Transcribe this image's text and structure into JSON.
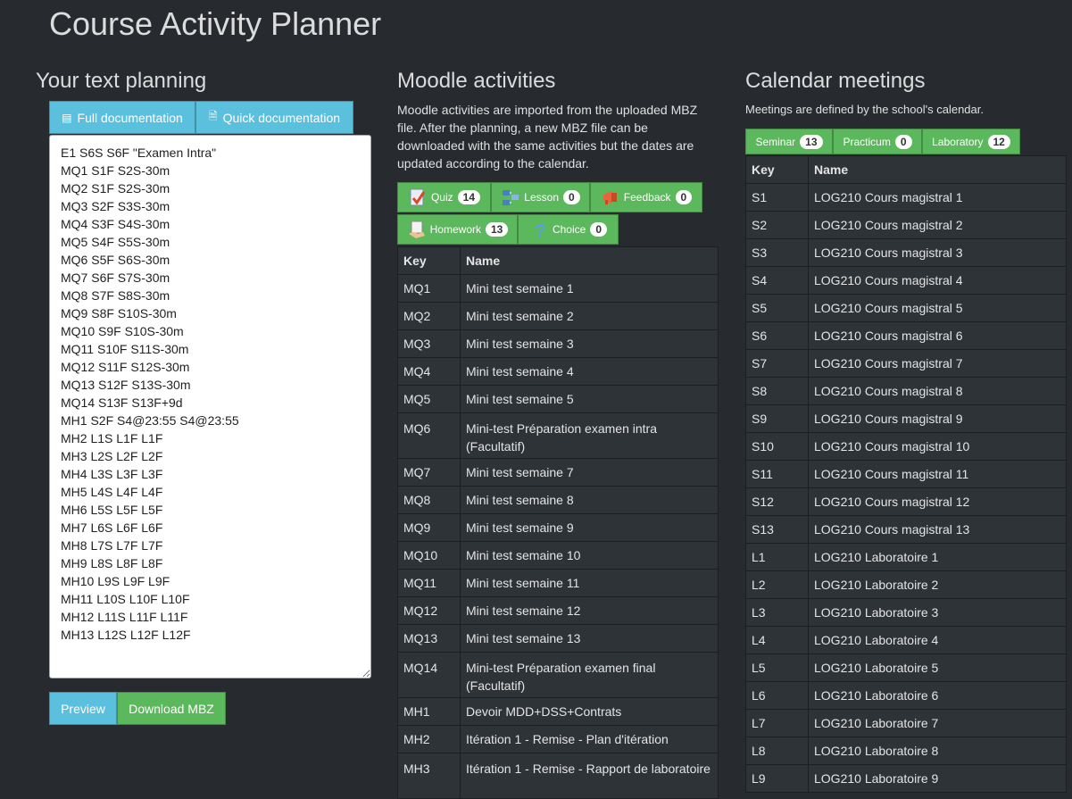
{
  "app_title": "Course Activity Planner",
  "left": {
    "title": "Your text planning",
    "full_doc_label": "Full documentation",
    "quick_doc_label": "Quick documentation",
    "planning_text": "E1 S6S S6F \"Examen Intra\"\nMQ1 S1F S2S-30m\nMQ2 S1F S2S-30m\nMQ3 S2F S3S-30m\nMQ4 S3F S4S-30m\nMQ5 S4F S5S-30m\nMQ6 S5F S6S-30m\nMQ7 S6F S7S-30m\nMQ8 S7F S8S-30m\nMQ9 S8F S10S-30m\nMQ10 S9F S10S-30m\nMQ11 S10F S11S-30m\nMQ12 S11F S12S-30m\nMQ13 S12F S13S-30m\nMQ14 S13F S13F+9d\nMH1 S2F S4@23:55 S4@23:55\nMH2 L1S L1F L1F\nMH3 L2S L2F L2F\nMH4 L3S L3F L3F\nMH5 L4S L4F L4F\nMH6 L5S L5F L5F\nMH7 L6S L6F L6F\nMH8 L7S L7F L7F\nMH9 L8S L8F L8F\nMH10 L9S L9F L9F\nMH11 L10S L10F L10F\nMH12 L11S L11F L11F\nMH13 L12S L12F L12F",
    "preview_label": "Preview",
    "download_label": "Download MBZ"
  },
  "middle": {
    "title": "Moodle activities",
    "description_lines": [
      "Moodle activities are imported from the uploaded MBZ",
      "file. After the planning, a new MBZ file can be",
      "downloaded with the same activities but the dates are",
      "updated according to the calendar."
    ],
    "filters": [
      {
        "label": "Quiz",
        "count": "14",
        "icon": "quiz-icon"
      },
      {
        "label": "Lesson",
        "count": "0",
        "icon": "lesson-icon"
      },
      {
        "label": "Feedback",
        "count": "0",
        "icon": "megaphone-icon"
      },
      {
        "label": "Homework",
        "count": "13",
        "icon": "homework-icon"
      },
      {
        "label": "Choice",
        "count": "0",
        "icon": "question-icon"
      }
    ],
    "table_headers": {
      "key": "Key",
      "name": "Name"
    },
    "rows": [
      {
        "key": "MQ1",
        "name": "Mini test semaine 1"
      },
      {
        "key": "MQ2",
        "name": "Mini test semaine 2"
      },
      {
        "key": "MQ3",
        "name": "Mini test semaine 3"
      },
      {
        "key": "MQ4",
        "name": "Mini test semaine 4"
      },
      {
        "key": "MQ5",
        "name": "Mini test semaine 5"
      },
      {
        "key": "MQ6",
        "name": "Mini-test Préparation examen intra (Facultatif)"
      },
      {
        "key": "MQ7",
        "name": "Mini test semaine 7"
      },
      {
        "key": "MQ8",
        "name": "Mini test semaine 8"
      },
      {
        "key": "MQ9",
        "name": "Mini test semaine 9"
      },
      {
        "key": "MQ10",
        "name": "Mini test semaine 10"
      },
      {
        "key": "MQ11",
        "name": "Mini test semaine 11"
      },
      {
        "key": "MQ12",
        "name": "Mini test semaine 12"
      },
      {
        "key": "MQ13",
        "name": "Mini test semaine 13"
      },
      {
        "key": "MQ14",
        "name": "Mini-test Préparation examen final (Facultatif)"
      },
      {
        "key": "MH1",
        "name": "Devoir MDD+DSS+Contrats"
      },
      {
        "key": "MH2",
        "name": "Itération 1 - Remise - Plan d'itération"
      },
      {
        "key": "MH3",
        "name": "Itération 1 - Remise - Rapport de laboratoire"
      }
    ]
  },
  "right": {
    "title": "Calendar meetings",
    "description": "Meetings are defined by the school's calendar.",
    "filters": [
      {
        "label": "Seminar",
        "count": "13"
      },
      {
        "label": "Practicum",
        "count": "0"
      },
      {
        "label": "Laboratory",
        "count": "12"
      }
    ],
    "table_headers": {
      "key": "Key",
      "name": "Name"
    },
    "rows": [
      {
        "key": "S1",
        "name": "LOG210 Cours magistral 1"
      },
      {
        "key": "S2",
        "name": "LOG210 Cours magistral 2"
      },
      {
        "key": "S3",
        "name": "LOG210 Cours magistral 3"
      },
      {
        "key": "S4",
        "name": "LOG210 Cours magistral 4"
      },
      {
        "key": "S5",
        "name": "LOG210 Cours magistral 5"
      },
      {
        "key": "S6",
        "name": "LOG210 Cours magistral 6"
      },
      {
        "key": "S7",
        "name": "LOG210 Cours magistral 7"
      },
      {
        "key": "S8",
        "name": "LOG210 Cours magistral 8"
      },
      {
        "key": "S9",
        "name": "LOG210 Cours magistral 9"
      },
      {
        "key": "S10",
        "name": "LOG210 Cours magistral 10"
      },
      {
        "key": "S11",
        "name": "LOG210 Cours magistral 11"
      },
      {
        "key": "S12",
        "name": "LOG210 Cours magistral 12"
      },
      {
        "key": "S13",
        "name": "LOG210 Cours magistral 13"
      },
      {
        "key": "L1",
        "name": "LOG210 Laboratoire 1"
      },
      {
        "key": "L2",
        "name": "LOG210 Laboratoire 2"
      },
      {
        "key": "L3",
        "name": "LOG210 Laboratoire 3"
      },
      {
        "key": "L4",
        "name": "LOG210 Laboratoire 4"
      },
      {
        "key": "L5",
        "name": "LOG210 Laboratoire 5"
      },
      {
        "key": "L6",
        "name": "LOG210 Laboratoire 6"
      },
      {
        "key": "L7",
        "name": "LOG210 Laboratoire 7"
      },
      {
        "key": "L8",
        "name": "LOG210 Laboratoire 8"
      },
      {
        "key": "L9",
        "name": "LOG210 Laboratoire 9"
      }
    ]
  }
}
